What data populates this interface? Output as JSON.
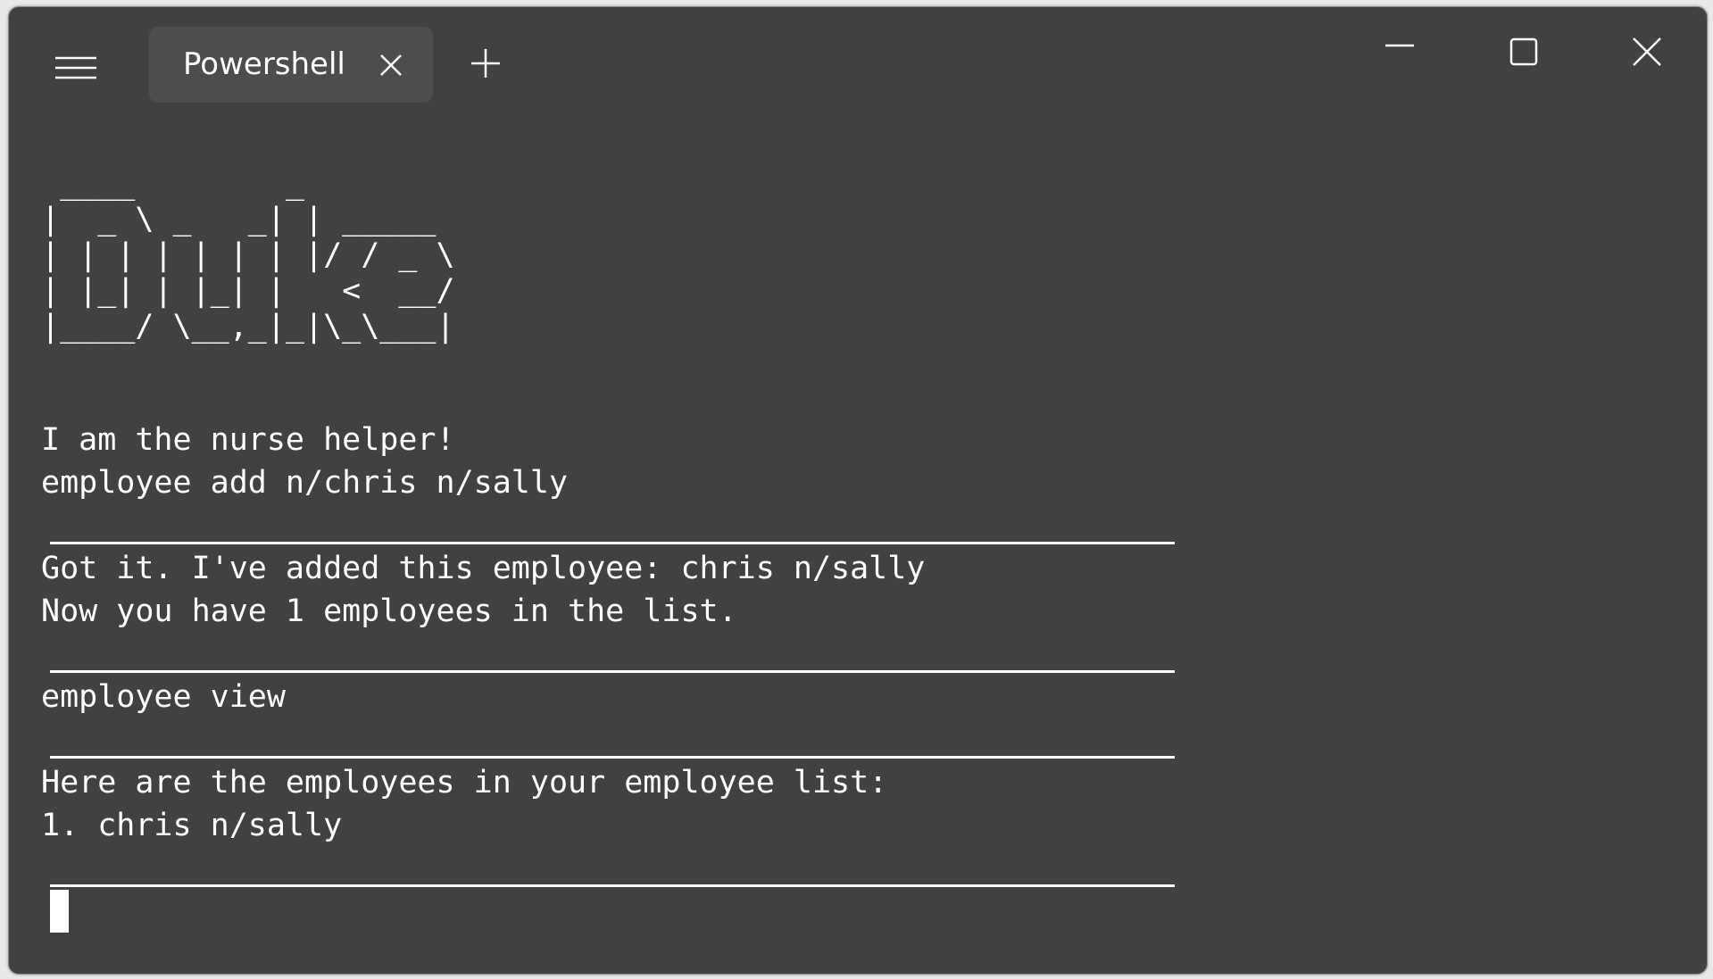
{
  "tab": {
    "title": "Powershell"
  },
  "icons": {
    "menu": "hamburger-menu-icon",
    "tab_close": "close-icon",
    "new_tab": "plus-icon",
    "minimize": "minimize-icon",
    "maximize": "maximize-icon",
    "close": "close-icon"
  },
  "colors": {
    "background": "#414141",
    "tab_background": "#4d4d4d",
    "text": "#ffffff"
  },
  "terminal": {
    "logo": [
      " ____        _        ",
      "|  _ \\ _   _| | _____ ",
      "| | | | | | | |/ / _ \\",
      "| |_| | |_| |   <  __/",
      "|____/ \\__,_|_|\\_\\___|"
    ],
    "greeting": "I am the nurse helper!",
    "command1": "employee add n/chris n/sally",
    "response1_line1": "Got it. I've added this employee: chris n/sally",
    "response1_line2": "Now you have 1 employees in the list.",
    "command2": "employee view",
    "response2_line1": "Here are the employees in your employee list:",
    "response2_line2": "1. chris n/sally"
  }
}
